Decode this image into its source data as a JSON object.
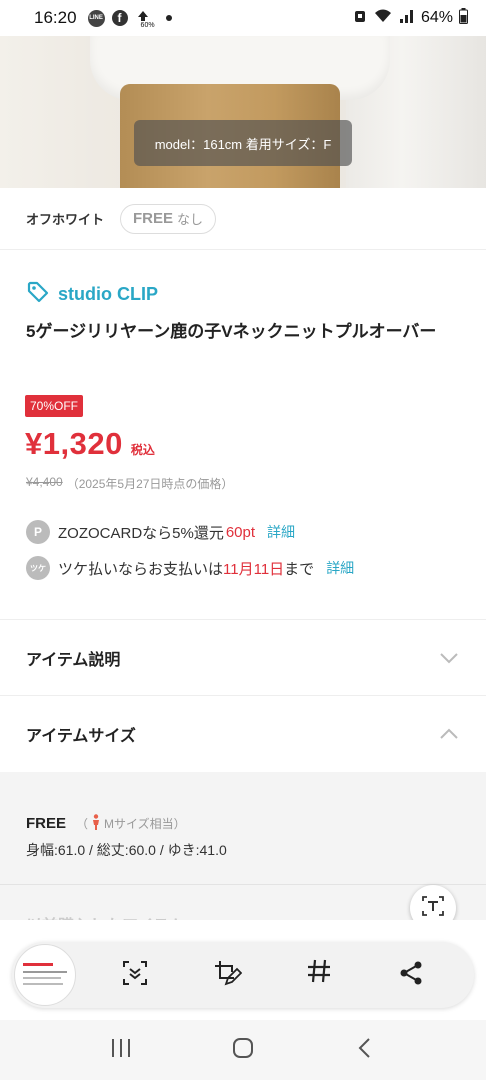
{
  "status_bar": {
    "time": "16:20",
    "line_label": "LINE",
    "fb_label": "f",
    "battery": "64%",
    "data_saver": "60%"
  },
  "hero": {
    "caption": "model：161cm 着用サイズ：F"
  },
  "variant": {
    "color": "オフホワイト",
    "size": "FREE",
    "stock": "なし"
  },
  "product": {
    "brand": "studio CLIP",
    "title": "5ゲージリリヤーン鹿の子Vネックニットプルオーバー",
    "discount": "70%OFF",
    "price": "¥1,320",
    "tax": "税込",
    "original_price": "¥4,400",
    "price_note": "（2025年5月27日時点の価格）"
  },
  "zozocard": {
    "badge": "P",
    "text": "ZOZOCARDなら5%還元",
    "points": "60pt",
    "link": "詳細"
  },
  "tsuke": {
    "badge": "ツケ",
    "text_before": "ツケ払いならお支払いは",
    "date": "11月11日",
    "text_after": "まで",
    "link": "詳細"
  },
  "accordions": {
    "description": "アイテム説明",
    "size": "アイテムサイズ"
  },
  "size_info": {
    "label": "FREE",
    "equiv_open": "（",
    "equiv": "Mサイズ相当）",
    "dimensions": "身幅:61.0 / 総丈:60.0 / ゆき:41.0",
    "next_section": "以前購入したアイテム"
  },
  "colors": {
    "accent": "#2aa7c6",
    "sale": "#e0303b"
  }
}
